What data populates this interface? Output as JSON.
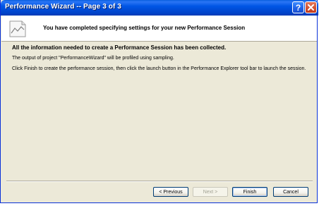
{
  "window": {
    "title": "Performance Wizard -- Page 3 of 3",
    "help_glyph": "?",
    "help_icon": "help-icon",
    "close_icon": "close-icon"
  },
  "header": {
    "icon": "performance-chart-icon",
    "text": "You have completed specifying settings for your new Performance Session"
  },
  "content": {
    "lead": "All the information needed to create a Performance Session has been collected.",
    "paragraph1": "The output of project  \"PerformanceWizard\" will be profiled using sampling.",
    "paragraph2": "Click Finish to create the performance session, then click the launch button in the Performance Explorer tool bar to launch the session."
  },
  "buttons": {
    "previous": "< Previous",
    "next": "Next >",
    "finish": "Finish",
    "cancel": "Cancel"
  },
  "colors": {
    "titlebar": "#0055e5",
    "dialog_bg": "#ece9d8",
    "close_button": "#d2502e"
  }
}
